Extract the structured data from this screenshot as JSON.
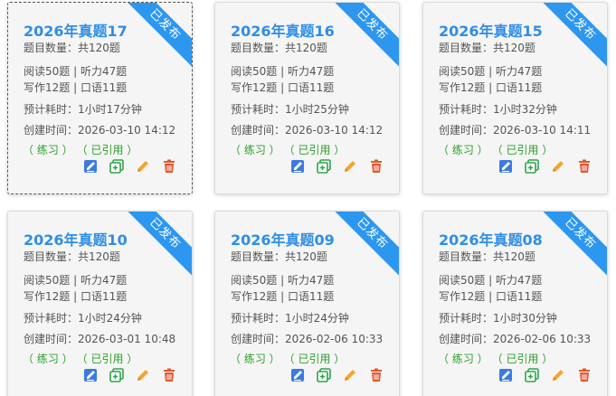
{
  "status_label": "已发布",
  "actions": {
    "publish": "publish-icon",
    "copy": "copy-icon",
    "edit": "edit-icon",
    "delete": "delete-icon"
  },
  "colors": {
    "accent": "#2d97f0",
    "title": "#2f8ee6",
    "tag": "#2aa12a",
    "publish": "#3b7be0",
    "copy": "#2fa34a",
    "edit": "#f3a532",
    "delete": "#e4572e"
  },
  "cards": [
    {
      "title": "2026年真题17",
      "count": "题目数量：共120题",
      "sections1": "阅读50题 | 听力47题",
      "sections2": "写作12题 | 口语11题",
      "duration": "预计耗时：1小时17分钟",
      "created": "创建时间：2026-03-10 14:12",
      "tag1": "（ 练习 ）",
      "tag2": "（ 已引用 ）",
      "selected": true
    },
    {
      "title": "2026年真题16",
      "count": "题目数量：共120题",
      "sections1": "阅读50题 | 听力47题",
      "sections2": "写作12题 | 口语11题",
      "duration": "预计耗时：1小时25分钟",
      "created": "创建时间：2026-03-10 14:12",
      "tag1": "（ 练习 ）",
      "tag2": "（ 已引用 ）",
      "selected": false
    },
    {
      "title": "2026年真题15",
      "count": "题目数量：共120题",
      "sections1": "阅读50题 | 听力47题",
      "sections2": "写作12题 | 口语11题",
      "duration": "预计耗时：1小时32分钟",
      "created": "创建时间：2026-03-10 14:11",
      "tag1": "（ 练习 ）",
      "tag2": "（ 已引用 ）",
      "selected": false
    },
    {
      "title": "2026年真题10",
      "count": "题目数量：共120题",
      "sections1": "阅读50题 | 听力47题",
      "sections2": "写作12题 | 口语11题",
      "duration": "预计耗时：1小时24分钟",
      "created": "创建时间：2026-03-01 10:48",
      "tag1": "（ 练习 ）",
      "tag2": "（ 已引用 ）",
      "selected": false
    },
    {
      "title": "2026年真题09",
      "count": "题目数量：共120题",
      "sections1": "阅读50题 | 听力47题",
      "sections2": "写作12题 | 口语11题",
      "duration": "预计耗时：1小时24分钟",
      "created": "创建时间：2026-02-06 10:33",
      "tag1": "（ 练习 ）",
      "tag2": "（ 已引用 ）",
      "selected": false
    },
    {
      "title": "2026年真题08",
      "count": "题目数量：共120题",
      "sections1": "阅读50题 | 听力47题",
      "sections2": "写作12题 | 口语11题",
      "duration": "预计耗时：1小时30分钟",
      "created": "创建时间：2026-02-06 10:33",
      "tag1": "（ 练习 ）",
      "tag2": "（ 已引用 ）",
      "selected": false
    }
  ]
}
